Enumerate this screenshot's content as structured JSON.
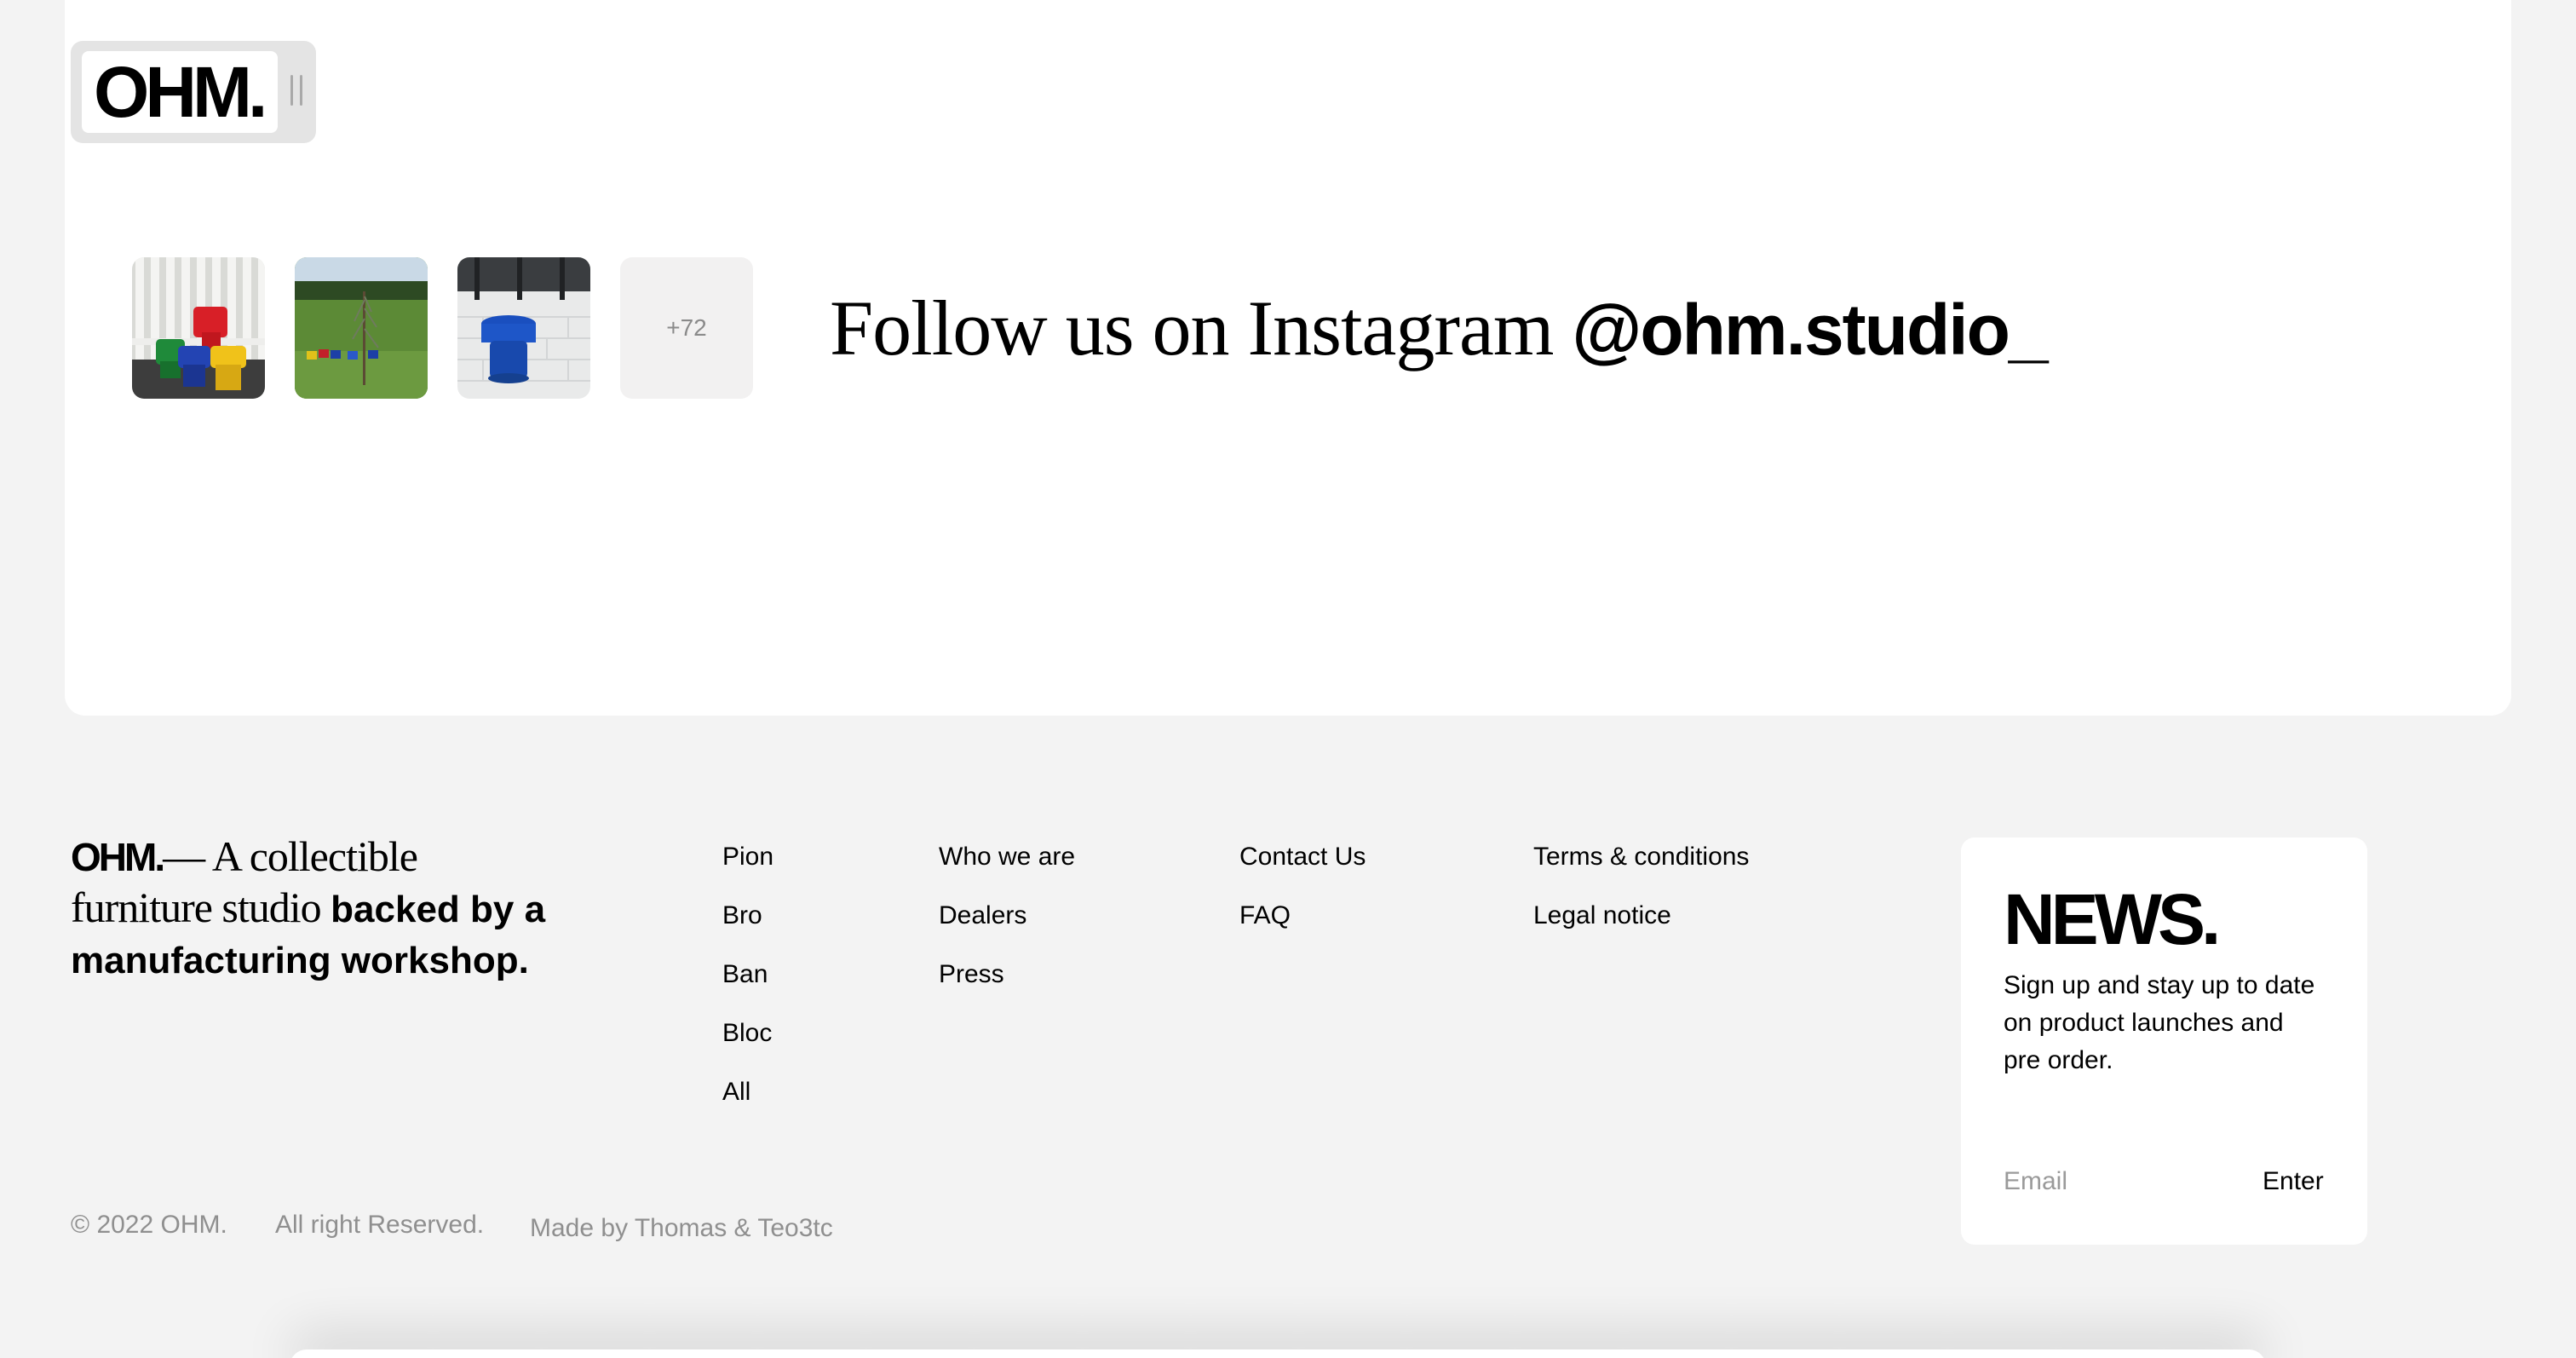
{
  "header": {
    "logo": "OHM.",
    "drag_handle_icon": "drag-handle-icon"
  },
  "instagram": {
    "thumbnails": [
      {
        "name": "instagram-thumb-colored-stools",
        "icon": "photo-icon"
      },
      {
        "name": "instagram-thumb-lawn",
        "icon": "photo-icon"
      },
      {
        "name": "instagram-thumb-blue-stool",
        "icon": "photo-icon"
      }
    ],
    "more_count": "+72",
    "follow_text": "Follow us on Instagram ",
    "handle": "@ohm.studio_"
  },
  "footer": {
    "tagline": {
      "brand": "OHM.",
      "dash": "— ",
      "serif_part": "A collectible furniture studio ",
      "sans_part": "backed by a manufacturing workshop."
    },
    "columns": [
      {
        "items": [
          "Pion",
          "Bro",
          "Ban",
          "Bloc",
          "All"
        ]
      },
      {
        "items": [
          "Who we are",
          "Dealers",
          "Press"
        ]
      },
      {
        "items": [
          "Contact Us",
          "FAQ"
        ]
      },
      {
        "items": [
          "Terms & conditions",
          "Legal notice"
        ]
      }
    ],
    "newsletter": {
      "title": "NEWS.",
      "description": "Sign up and stay up to date on product launches and pre order.",
      "email_placeholder": "Email",
      "email_value": "",
      "submit_label": "Enter"
    },
    "legal": {
      "copyright": "© 2022 OHM.",
      "rights": "All right Reserved.",
      "credits": "Made by Thomas & Teo3tc"
    }
  },
  "colors": {
    "page_background": "#f3f3f3",
    "card_background": "#ffffff",
    "muted_text": "#8f8f8f",
    "logo_pill": "#e4e4e4"
  }
}
